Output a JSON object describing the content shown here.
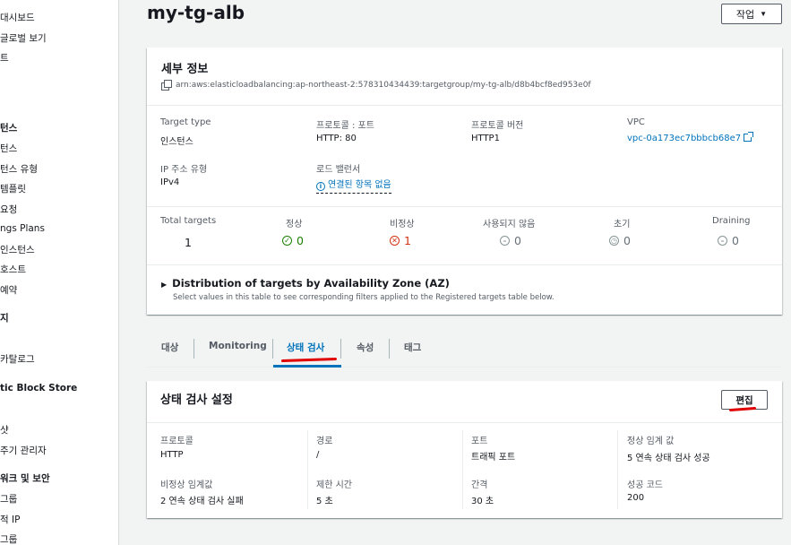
{
  "sidebar": {
    "items": [
      {
        "label": "대시보드",
        "bold": false
      },
      {
        "label": "글로벌 보기",
        "bold": false
      },
      {
        "label": "트",
        "bold": false
      },
      {
        "label": "턴스",
        "bold": true
      },
      {
        "label": "턴스",
        "bold": false
      },
      {
        "label": "턴스 유형",
        "bold": false
      },
      {
        "label": "템플릿",
        "bold": false
      },
      {
        "label": "요청",
        "bold": false
      },
      {
        "label": "ngs Plans",
        "bold": false
      },
      {
        "label": "인스턴스",
        "bold": false
      },
      {
        "label": "호스트",
        "bold": false
      },
      {
        "label": "예약",
        "bold": false
      },
      {
        "label": "지",
        "bold": true
      },
      {
        "label": "카탈로그",
        "bold": false
      },
      {
        "label": "tic Block Store",
        "bold": true
      },
      {
        "label": "샷",
        "bold": false
      },
      {
        "label": "주기 관리자",
        "bold": false
      },
      {
        "label": "워크 및 보안",
        "bold": true
      },
      {
        "label": "그룹",
        "bold": false
      },
      {
        "label": "적 IP",
        "bold": false
      },
      {
        "label": "그룹",
        "bold": false
      }
    ]
  },
  "header": {
    "title": "my-tg-alb",
    "action_label": "작업"
  },
  "details": {
    "title": "세부 정보",
    "arn": "arn:aws:elasticloadbalancing:ap-northeast-2:578310434439:targetgroup/my-tg-alb/d8b4bcf8ed953e0f",
    "fields": {
      "target_type_label": "Target type",
      "target_type_value": "인스턴스",
      "protocol_port_label": "프로토콜 : 포트",
      "protocol_port_value": "HTTP: 80",
      "protocol_version_label": "프로토콜 버전",
      "protocol_version_value": "HTTP1",
      "vpc_label": "VPC",
      "vpc_value": "vpc-0a173ec7bbbcb68e7",
      "ip_type_label": "IP 주소 유형",
      "ip_type_value": "IPv4",
      "lb_label": "로드 밸런서",
      "lb_value": "연결된 항목 없음"
    },
    "stats": [
      {
        "label": "Total targets",
        "value": "1",
        "status": "none",
        "color": "#16191f"
      },
      {
        "label": "정상",
        "value": "0",
        "status": "healthy",
        "color": "#1d8102"
      },
      {
        "label": "비정상",
        "value": "1",
        "status": "unhealthy",
        "color": "#d13212"
      },
      {
        "label": "사용되지 않음",
        "value": "0",
        "status": "unused",
        "color": "#687078"
      },
      {
        "label": "초기",
        "value": "0",
        "status": "initial",
        "color": "#687078"
      },
      {
        "label": "Draining",
        "value": "0",
        "status": "draining",
        "color": "#687078"
      }
    ],
    "distribution_title": "Distribution of targets by Availability Zone (AZ)",
    "distribution_subtitle": "Select values in this table to see corresponding filters applied to the Registered targets table below."
  },
  "tabs": [
    {
      "label": "대상",
      "active": false
    },
    {
      "label": "Monitoring",
      "active": false
    },
    {
      "label": "상태 검사",
      "active": true
    },
    {
      "label": "속성",
      "active": false
    },
    {
      "label": "태그",
      "active": false
    }
  ],
  "health_check": {
    "title": "상태 검사 설정",
    "edit_label": "편집",
    "fields": [
      {
        "label": "프로토콜",
        "value": "HTTP"
      },
      {
        "label": "경로",
        "value": "/"
      },
      {
        "label": "포트",
        "value": "트래픽 포트"
      },
      {
        "label": "정상 임계 값",
        "value": "5 연속 상태 검사 성공"
      },
      {
        "label": "비정상 임계값",
        "value": "2 연속 상태 검사 실패"
      },
      {
        "label": "제한 시간",
        "value": "5 초"
      },
      {
        "label": "간격",
        "value": "30 초"
      },
      {
        "label": "성공 코드",
        "value": "200"
      }
    ]
  },
  "colors": {
    "link": "#0073bb",
    "healthy": "#1d8102",
    "unhealthy": "#d13212",
    "annotation_red": "#e00000"
  }
}
